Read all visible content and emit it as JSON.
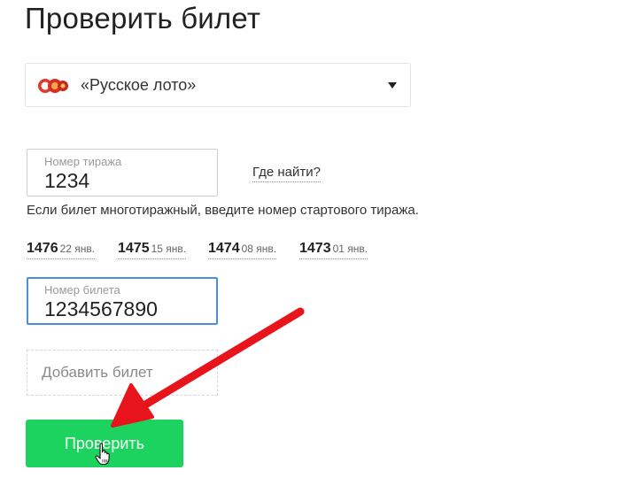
{
  "page": {
    "title": "Проверить билет"
  },
  "lottery": {
    "selected": "«Русское лото»",
    "icon": "russkoe-loto-logo"
  },
  "draw_field": {
    "label": "Номер тиража",
    "value": "1234"
  },
  "where_to_find": "Где найти?",
  "hint": "Если билет многотиражный, введите номер стартового тиража.",
  "recent_draws": [
    {
      "number": "1476",
      "date": "22 янв."
    },
    {
      "number": "1475",
      "date": "15 янв."
    },
    {
      "number": "1474",
      "date": "08 янв."
    },
    {
      "number": "1473",
      "date": "01 янв."
    }
  ],
  "ticket_field": {
    "label": "Номер билета",
    "value": "1234567890"
  },
  "add_ticket": "Добавить билет",
  "check_button": "Проверить",
  "colors": {
    "button": "#1dd35f",
    "focus_border": "#4d8fd6",
    "annotation_arrow": "#e8141b"
  }
}
